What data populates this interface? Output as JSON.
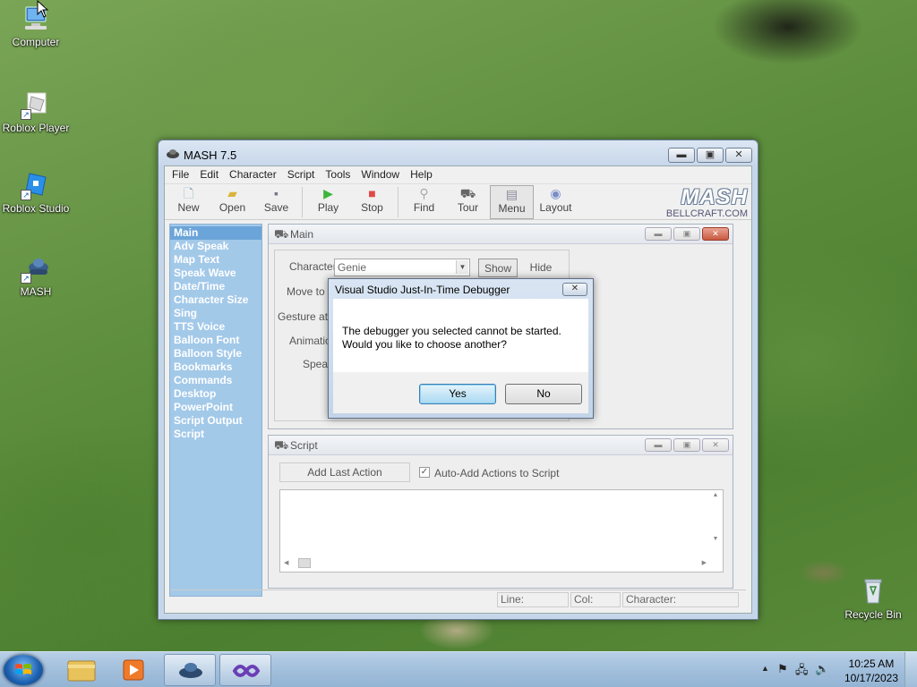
{
  "desktop": {
    "icons": [
      {
        "label": "Computer",
        "icon": "computer-icon"
      },
      {
        "label": "Roblox Player",
        "icon": "roblox-player-icon"
      },
      {
        "label": "Roblox Studio",
        "icon": "roblox-studio-icon"
      },
      {
        "label": "MASH",
        "icon": "mash-icon"
      },
      {
        "label": "Recycle Bin",
        "icon": "recycle-bin-icon"
      }
    ]
  },
  "window": {
    "title": "MASH 7.5",
    "menu": [
      "File",
      "Edit",
      "Character",
      "Script",
      "Tools",
      "Window",
      "Help"
    ],
    "toolbar": [
      "New",
      "Open",
      "Save",
      "Play",
      "Stop",
      "Find",
      "Tour",
      "Menu",
      "Layout"
    ],
    "brand_logo": "MASH",
    "brand_url": "BELLCRAFT.COM",
    "nav": [
      "Main",
      "Adv Speak",
      "Map Text",
      "Speak Wave",
      "Date/Time",
      "Character Size",
      "Sing",
      "TTS Voice",
      "Balloon Font",
      "Balloon Style",
      "Bookmarks",
      "Commands",
      "Desktop",
      "PowerPoint",
      "Script Output",
      "Script"
    ],
    "main_panel": {
      "title": "Main",
      "character_label": "Character",
      "character_value": "Genie",
      "show_label": "Show",
      "hide_label": "Hide",
      "move_to_label": "Move to X",
      "gesture_label": "Gesture at X",
      "animation_label": "Animatio",
      "speak_label": "Speak"
    },
    "script_panel": {
      "title": "Script",
      "add_last_action": "Add Last Action",
      "auto_add_label": "Auto-Add Actions to Script",
      "auto_add_checked": true
    },
    "status": {
      "line_label": "Line:",
      "col_label": "Col:",
      "character_label": "Character:"
    }
  },
  "dialog": {
    "title": "Visual Studio Just-In-Time Debugger",
    "message_line1": "The debugger you selected cannot be started.",
    "message_line2": "Would you like to choose another?",
    "yes_label": "Yes",
    "no_label": "No"
  },
  "taskbar": {
    "time": "10:25 AM",
    "date": "10/17/2023"
  }
}
